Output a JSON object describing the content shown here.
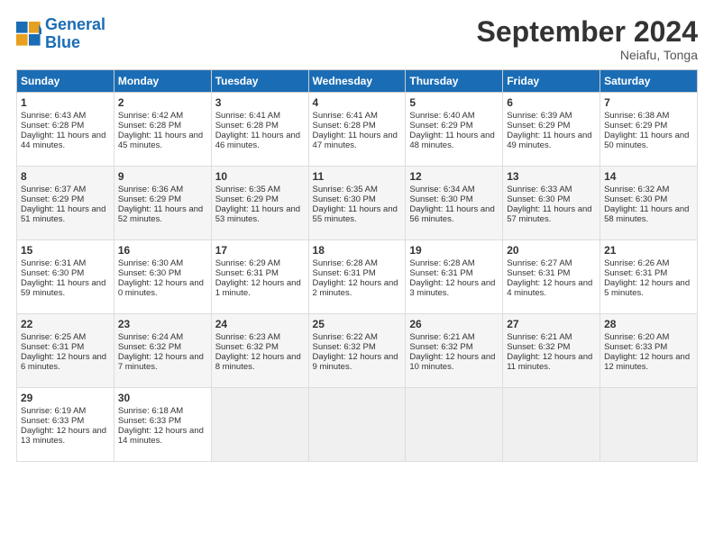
{
  "logo": {
    "line1": "General",
    "line2": "Blue"
  },
  "title": "September 2024",
  "location": "Neiafu, Tonga",
  "headers": [
    "Sunday",
    "Monday",
    "Tuesday",
    "Wednesday",
    "Thursday",
    "Friday",
    "Saturday"
  ],
  "weeks": [
    [
      {
        "day": "1",
        "sunrise": "Sunrise: 6:43 AM",
        "sunset": "Sunset: 6:28 PM",
        "daylight": "Daylight: 11 hours and 44 minutes."
      },
      {
        "day": "2",
        "sunrise": "Sunrise: 6:42 AM",
        "sunset": "Sunset: 6:28 PM",
        "daylight": "Daylight: 11 hours and 45 minutes."
      },
      {
        "day": "3",
        "sunrise": "Sunrise: 6:41 AM",
        "sunset": "Sunset: 6:28 PM",
        "daylight": "Daylight: 11 hours and 46 minutes."
      },
      {
        "day": "4",
        "sunrise": "Sunrise: 6:41 AM",
        "sunset": "Sunset: 6:28 PM",
        "daylight": "Daylight: 11 hours and 47 minutes."
      },
      {
        "day": "5",
        "sunrise": "Sunrise: 6:40 AM",
        "sunset": "Sunset: 6:29 PM",
        "daylight": "Daylight: 11 hours and 48 minutes."
      },
      {
        "day": "6",
        "sunrise": "Sunrise: 6:39 AM",
        "sunset": "Sunset: 6:29 PM",
        "daylight": "Daylight: 11 hours and 49 minutes."
      },
      {
        "day": "7",
        "sunrise": "Sunrise: 6:38 AM",
        "sunset": "Sunset: 6:29 PM",
        "daylight": "Daylight: 11 hours and 50 minutes."
      }
    ],
    [
      {
        "day": "8",
        "sunrise": "Sunrise: 6:37 AM",
        "sunset": "Sunset: 6:29 PM",
        "daylight": "Daylight: 11 hours and 51 minutes."
      },
      {
        "day": "9",
        "sunrise": "Sunrise: 6:36 AM",
        "sunset": "Sunset: 6:29 PM",
        "daylight": "Daylight: 11 hours and 52 minutes."
      },
      {
        "day": "10",
        "sunrise": "Sunrise: 6:35 AM",
        "sunset": "Sunset: 6:29 PM",
        "daylight": "Daylight: 11 hours and 53 minutes."
      },
      {
        "day": "11",
        "sunrise": "Sunrise: 6:35 AM",
        "sunset": "Sunset: 6:30 PM",
        "daylight": "Daylight: 11 hours and 55 minutes."
      },
      {
        "day": "12",
        "sunrise": "Sunrise: 6:34 AM",
        "sunset": "Sunset: 6:30 PM",
        "daylight": "Daylight: 11 hours and 56 minutes."
      },
      {
        "day": "13",
        "sunrise": "Sunrise: 6:33 AM",
        "sunset": "Sunset: 6:30 PM",
        "daylight": "Daylight: 11 hours and 57 minutes."
      },
      {
        "day": "14",
        "sunrise": "Sunrise: 6:32 AM",
        "sunset": "Sunset: 6:30 PM",
        "daylight": "Daylight: 11 hours and 58 minutes."
      }
    ],
    [
      {
        "day": "15",
        "sunrise": "Sunrise: 6:31 AM",
        "sunset": "Sunset: 6:30 PM",
        "daylight": "Daylight: 11 hours and 59 minutes."
      },
      {
        "day": "16",
        "sunrise": "Sunrise: 6:30 AM",
        "sunset": "Sunset: 6:30 PM",
        "daylight": "Daylight: 12 hours and 0 minutes."
      },
      {
        "day": "17",
        "sunrise": "Sunrise: 6:29 AM",
        "sunset": "Sunset: 6:31 PM",
        "daylight": "Daylight: 12 hours and 1 minute."
      },
      {
        "day": "18",
        "sunrise": "Sunrise: 6:28 AM",
        "sunset": "Sunset: 6:31 PM",
        "daylight": "Daylight: 12 hours and 2 minutes."
      },
      {
        "day": "19",
        "sunrise": "Sunrise: 6:28 AM",
        "sunset": "Sunset: 6:31 PM",
        "daylight": "Daylight: 12 hours and 3 minutes."
      },
      {
        "day": "20",
        "sunrise": "Sunrise: 6:27 AM",
        "sunset": "Sunset: 6:31 PM",
        "daylight": "Daylight: 12 hours and 4 minutes."
      },
      {
        "day": "21",
        "sunrise": "Sunrise: 6:26 AM",
        "sunset": "Sunset: 6:31 PM",
        "daylight": "Daylight: 12 hours and 5 minutes."
      }
    ],
    [
      {
        "day": "22",
        "sunrise": "Sunrise: 6:25 AM",
        "sunset": "Sunset: 6:31 PM",
        "daylight": "Daylight: 12 hours and 6 minutes."
      },
      {
        "day": "23",
        "sunrise": "Sunrise: 6:24 AM",
        "sunset": "Sunset: 6:32 PM",
        "daylight": "Daylight: 12 hours and 7 minutes."
      },
      {
        "day": "24",
        "sunrise": "Sunrise: 6:23 AM",
        "sunset": "Sunset: 6:32 PM",
        "daylight": "Daylight: 12 hours and 8 minutes."
      },
      {
        "day": "25",
        "sunrise": "Sunrise: 6:22 AM",
        "sunset": "Sunset: 6:32 PM",
        "daylight": "Daylight: 12 hours and 9 minutes."
      },
      {
        "day": "26",
        "sunrise": "Sunrise: 6:21 AM",
        "sunset": "Sunset: 6:32 PM",
        "daylight": "Daylight: 12 hours and 10 minutes."
      },
      {
        "day": "27",
        "sunrise": "Sunrise: 6:21 AM",
        "sunset": "Sunset: 6:32 PM",
        "daylight": "Daylight: 12 hours and 11 minutes."
      },
      {
        "day": "28",
        "sunrise": "Sunrise: 6:20 AM",
        "sunset": "Sunset: 6:33 PM",
        "daylight": "Daylight: 12 hours and 12 minutes."
      }
    ],
    [
      {
        "day": "29",
        "sunrise": "Sunrise: 6:19 AM",
        "sunset": "Sunset: 6:33 PM",
        "daylight": "Daylight: 12 hours and 13 minutes."
      },
      {
        "day": "30",
        "sunrise": "Sunrise: 6:18 AM",
        "sunset": "Sunset: 6:33 PM",
        "daylight": "Daylight: 12 hours and 14 minutes."
      },
      null,
      null,
      null,
      null,
      null
    ]
  ]
}
